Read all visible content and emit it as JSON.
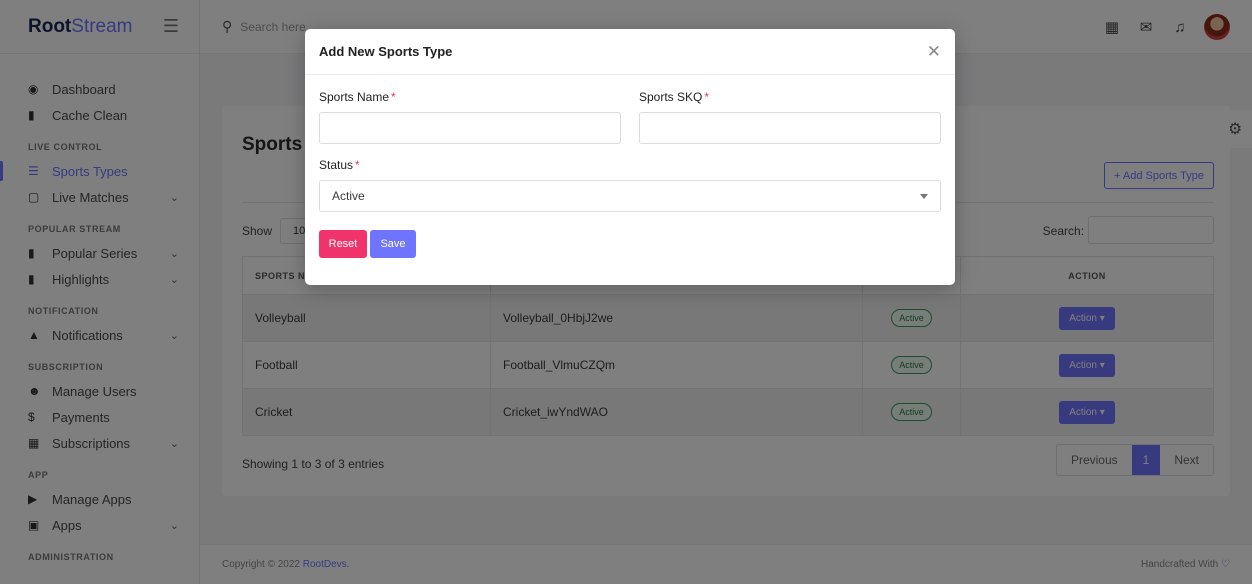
{
  "brand": {
    "bold": "Root",
    "light": "Stream"
  },
  "sidebar": {
    "items": [
      {
        "label": "Dashboard",
        "icon": "dashboard-icon"
      },
      {
        "label": "Cache Clean",
        "icon": "trash-icon"
      }
    ],
    "sections": {
      "live_control": "LIVE CONTROL",
      "popular_stream": "POPULAR STREAM",
      "notification": "NOTIFICATION",
      "subscription": "SUBSCRIPTION",
      "app": "APP",
      "administration": "ADMINISTRATION"
    },
    "live": [
      {
        "label": "Sports Types",
        "active": true
      },
      {
        "label": "Live Matches"
      }
    ],
    "popular": [
      {
        "label": "Popular Series"
      },
      {
        "label": "Highlights"
      }
    ],
    "notif": [
      {
        "label": "Notifications"
      }
    ],
    "subs": [
      {
        "label": "Manage Users"
      },
      {
        "label": "Payments"
      },
      {
        "label": "Subscriptions"
      }
    ],
    "apps": [
      {
        "label": "Manage Apps"
      },
      {
        "label": "Apps"
      }
    ]
  },
  "topbar": {
    "search_placeholder": "Search here"
  },
  "page": {
    "title": "Sports",
    "add_button": "+ Add Sports Type",
    "show_label": "Show",
    "show_value": "10",
    "search_label": "Search:",
    "table": {
      "headers": [
        "SPORTS NA",
        "",
        "",
        "ACTION"
      ],
      "rows": [
        {
          "name": "Volleyball",
          "skq": "Volleyball_0HbjJ2we",
          "status": "Active",
          "action": "Action"
        },
        {
          "name": "Football",
          "skq": "Football_VlmuCZQm",
          "status": "Active",
          "action": "Action"
        },
        {
          "name": "Cricket",
          "skq": "Cricket_iwYndWAO",
          "status": "Active",
          "action": "Action"
        }
      ]
    },
    "showing": "Showing 1 to 3 of 3 entries",
    "pager": {
      "prev": "Previous",
      "current": "1",
      "next": "Next"
    }
  },
  "footer": {
    "copyright": "Copyright © 2022 ",
    "company": "RootDevs.",
    "handcrafted": "Handcrafted With"
  },
  "modal": {
    "title": "Add New Sports Type",
    "sports_name_label": "Sports Name",
    "sports_skq_label": "Sports SKQ",
    "status_label": "Status",
    "status_value": "Active",
    "required_mark": "*",
    "reset": "Reset",
    "save": "Save"
  },
  "colors": {
    "accent": "#6f74ff",
    "danger": "#f0336a",
    "success": "#2a7a45"
  }
}
